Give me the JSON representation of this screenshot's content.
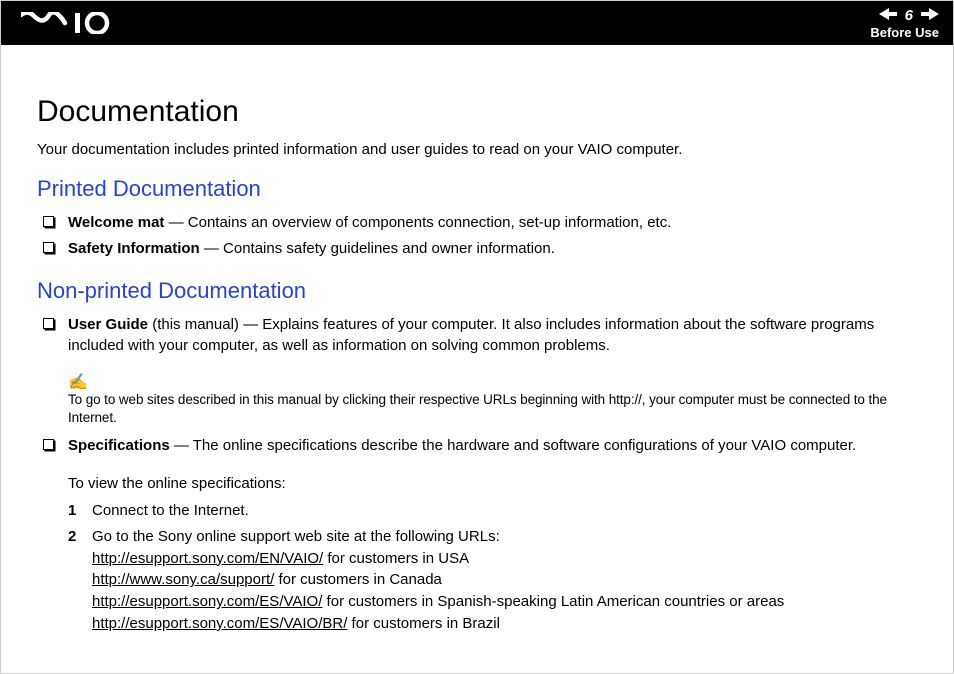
{
  "header": {
    "page_number": "6",
    "section": "Before Use"
  },
  "page": {
    "title": "Documentation",
    "intro": "Your documentation includes printed information and user guides to read on your VAIO computer.",
    "printed": {
      "heading": "Printed Documentation",
      "items": [
        {
          "term": "Welcome mat",
          "desc": " — Contains an overview of components connection, set-up information, etc."
        },
        {
          "term": "Safety Information",
          "desc": " — Contains safety guidelines and owner information."
        }
      ]
    },
    "nonprinted": {
      "heading": "Non-printed Documentation",
      "user_guide_term": "User Guide",
      "user_guide_desc": " (this manual) — Explains features of your computer. It also includes information about the software programs included with your computer, as well as information on solving common problems.",
      "note_icon": "✍",
      "note_text": "To go to web sites described in this manual by clicking their respective URLs beginning with http://, your computer must be connected to the Internet.",
      "spec_term": "Specifications",
      "spec_desc": " — The online specifications describe the hardware and software configurations of your VAIO computer.",
      "spec_sub": "To view the online specifications:",
      "steps": {
        "s1_num": "1",
        "s1_text": "Connect to the Internet.",
        "s2_num": "2",
        "s2_intro": "Go to the Sony online support web site at the following URLs:",
        "s2_url1": "http://esupport.sony.com/EN/VAIO/",
        "s2_url1_tail": " for customers in USA",
        "s2_url2": "http://www.sony.ca/support/",
        "s2_url2_tail": " for customers in Canada",
        "s2_url3": "http://esupport.sony.com/ES/VAIO/",
        "s2_url3_tail": " for customers in Spanish-speaking Latin American countries or areas",
        "s2_url4": "http://esupport.sony.com/ES/VAIO/BR/",
        "s2_url4_tail": " for customers in Brazil"
      }
    }
  }
}
